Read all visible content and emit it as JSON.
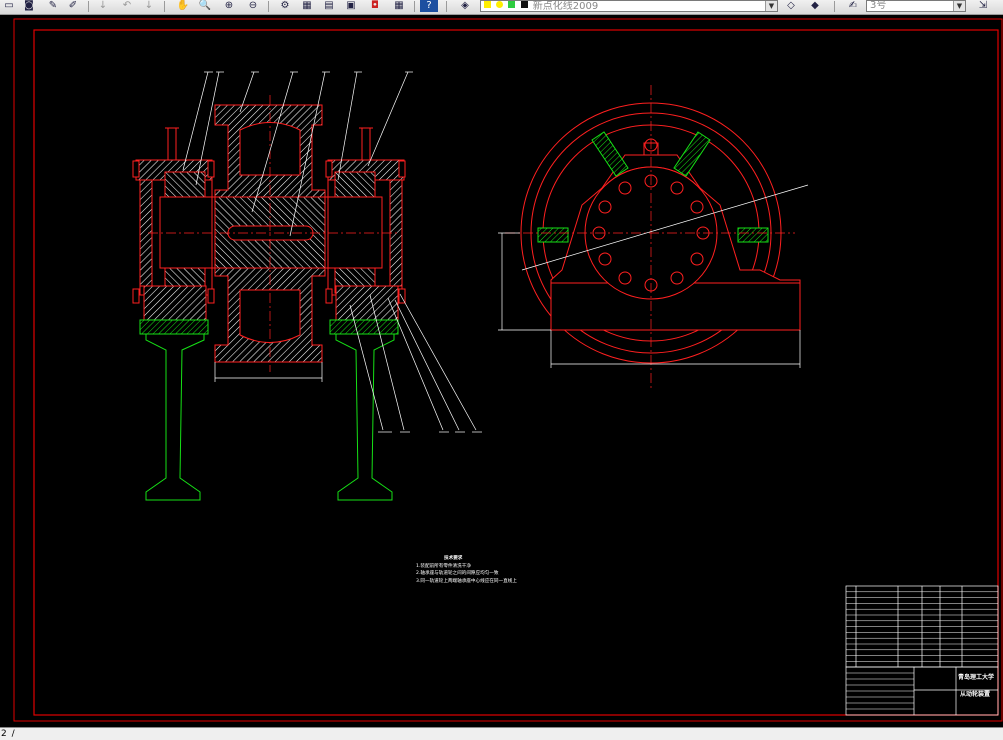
{
  "toolbar": {
    "layer_combo_text": "新点化线2009",
    "font_combo_text": "3号",
    "colors": {
      "yellow": "#ffee00",
      "green": "#2ecc40",
      "black": "#111111"
    }
  },
  "drawing": {
    "notes": {
      "title": "技术要求",
      "lines": [
        "1.装配前所有零件清洗干净",
        "2.轴承座与轨道轮之间的间隙应均匀一致",
        "3.同一轨道轮上两端轴承座中心线应在同一直线上"
      ]
    },
    "title_block": {
      "university": "青岛理工大学",
      "drawing_name": "从动轮装置"
    },
    "colors": {
      "frame": "#e00000",
      "part": "#ff2020",
      "rail": "#16e016",
      "dimension": "#ffffff",
      "background": "#000000"
    }
  },
  "status": {
    "text": "2"
  }
}
